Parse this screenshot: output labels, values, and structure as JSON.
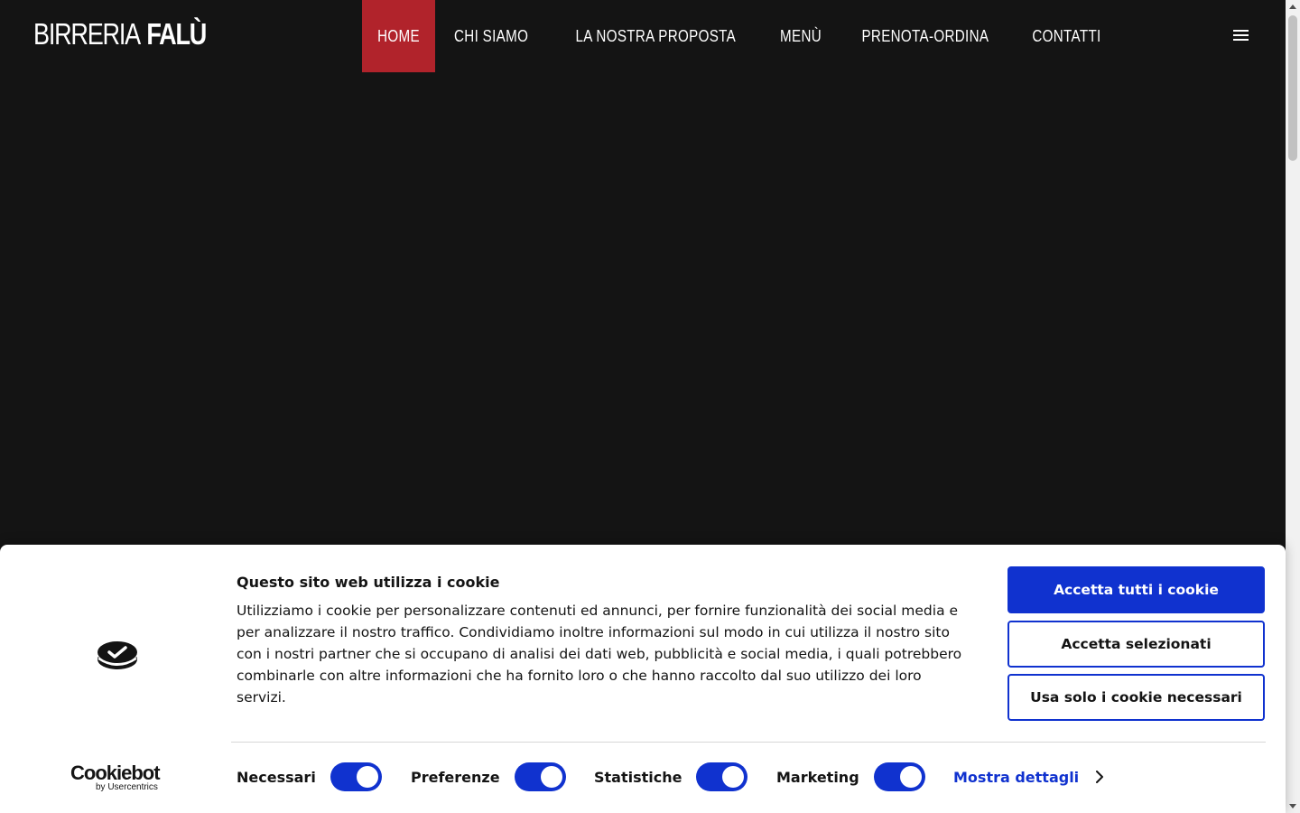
{
  "header": {
    "logo_light": "BIRRERIA",
    "logo_bold": "FALÙ",
    "nav": [
      {
        "label": "HOME",
        "active": true
      },
      {
        "label": "CHI SIAMO",
        "active": false
      },
      {
        "label": "LA NOSTRA PROPOSTA",
        "active": false
      },
      {
        "label": "MENÙ",
        "active": false
      },
      {
        "label": "PRENOTA-ORDINA",
        "active": false
      },
      {
        "label": "CONTATTI",
        "active": false
      }
    ],
    "menu_icon": "hamburger-menu-icon",
    "active_color": "#b1232b"
  },
  "cookie_banner": {
    "title": "Questo sito web utilizza i cookie",
    "body": "Utilizziamo i cookie per personalizzare contenuti ed annunci, per fornire funzionalità dei social media e per analizzare il nostro traffico. Condividiamo inoltre informazioni sul modo in cui utilizza il nostro sito con i nostri partner che si occupano di analisi dei dati web, pubblicità e social media, i quali potrebbero combinarle con altre informazioni che ha fornito loro o che hanno raccolto dal suo utilizzo dei loro servizi.",
    "buttons": {
      "accept_all": "Accetta tutti i cookie",
      "accept_selected": "Accetta selezionati",
      "necessary_only": "Usa solo i cookie necessari"
    },
    "toggles": {
      "necessari": {
        "label": "Necessari",
        "on": true
      },
      "preferenze": {
        "label": "Preferenze",
        "on": true
      },
      "statistiche": {
        "label": "Statistiche",
        "on": true
      },
      "marketing": {
        "label": "Marketing",
        "on": true
      }
    },
    "show_details": "Mostra dettagli",
    "brand_name": "Cookiebot",
    "brand_sub": "by Usercentrics",
    "accent_color": "#1032cf"
  }
}
